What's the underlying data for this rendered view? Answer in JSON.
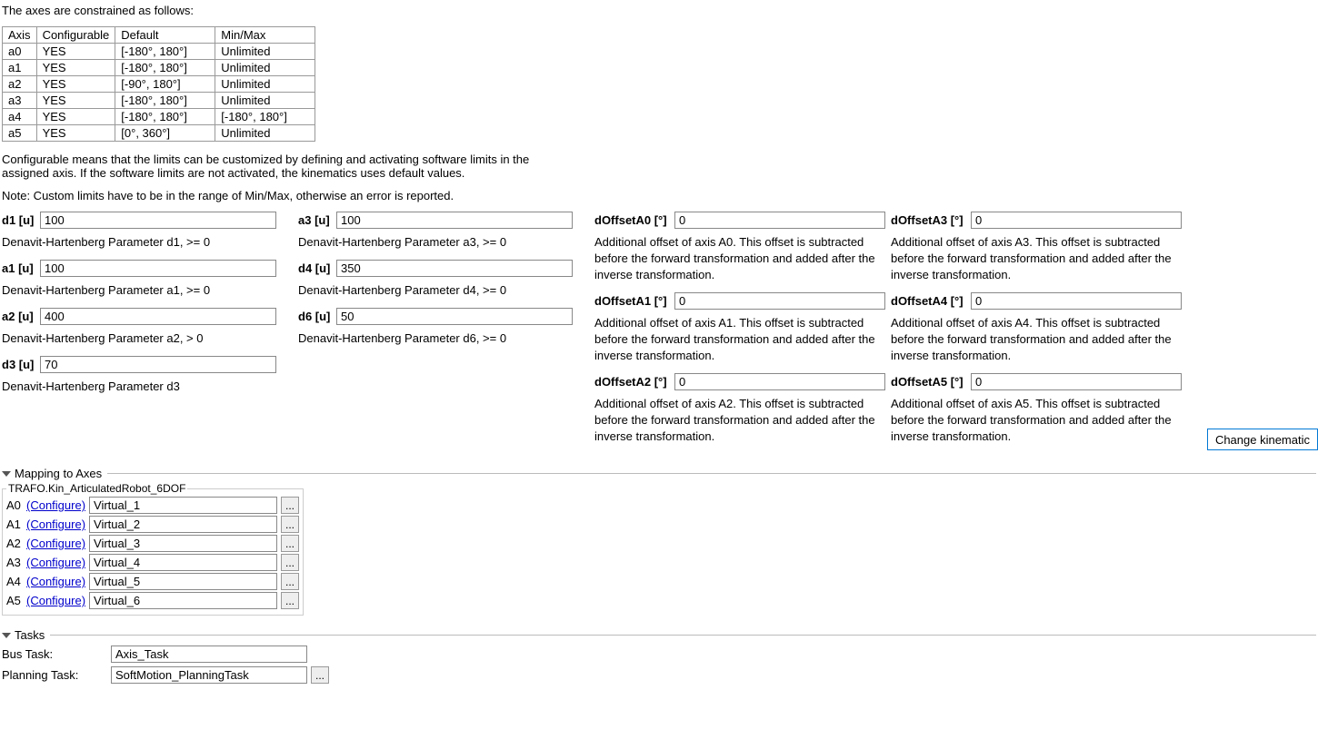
{
  "intro": {
    "heading": "The axes are constrained as follows:",
    "configurable_note": "Configurable means that the limits can be customized by defining and activating software limits in the assigned axis. If the software limits are not activated, the kinematics uses default values.",
    "minmax_note": "Note: Custom limits have to be in the range of Min/Max, otherwise an error is reported."
  },
  "constraint_table": {
    "headers": [
      "Axis",
      "Configurable",
      "Default",
      "Min/Max"
    ],
    "rows": [
      {
        "axis": "a0",
        "config": "YES",
        "default": "[-180°, 180°]",
        "minmax": "Unlimited"
      },
      {
        "axis": "a1",
        "config": "YES",
        "default": "[-180°, 180°]",
        "minmax": "Unlimited"
      },
      {
        "axis": "a2",
        "config": "YES",
        "default": "[-90°, 180°]",
        "minmax": "Unlimited"
      },
      {
        "axis": "a3",
        "config": "YES",
        "default": "[-180°, 180°]",
        "minmax": "Unlimited"
      },
      {
        "axis": "a4",
        "config": "YES",
        "default": "[-180°, 180°]",
        "minmax": "[-180°, 180°]"
      },
      {
        "axis": "a5",
        "config": "YES",
        "default": "[0°, 360°]",
        "minmax": "Unlimited"
      }
    ]
  },
  "dh_params": {
    "d1": {
      "label": "d1 [u]",
      "value": "100",
      "desc": "Denavit-Hartenberg Parameter d1, >= 0"
    },
    "a1": {
      "label": "a1 [u]",
      "value": "100",
      "desc": "Denavit-Hartenberg Parameter a1, >= 0"
    },
    "a2": {
      "label": "a2 [u]",
      "value": "400",
      "desc": "Denavit-Hartenberg Parameter a2, > 0"
    },
    "d3": {
      "label": "d3 [u]",
      "value": "70",
      "desc": "Denavit-Hartenberg Parameter d3"
    },
    "a3": {
      "label": "a3 [u]",
      "value": "100",
      "desc": "Denavit-Hartenberg Parameter a3, >= 0"
    },
    "d4": {
      "label": "d4 [u]",
      "value": "350",
      "desc": "Denavit-Hartenberg Parameter d4, >= 0"
    },
    "d6": {
      "label": "d6 [u]",
      "value": "50",
      "desc": "Denavit-Hartenberg Parameter d6, >= 0"
    }
  },
  "offsets": {
    "A0": {
      "label": "dOffsetA0 [°]",
      "value": "0",
      "desc": "Additional offset of axis A0. This offset is subtracted before the forward transformation and added after the inverse transformation."
    },
    "A1": {
      "label": "dOffsetA1 [°]",
      "value": "0",
      "desc": "Additional offset of axis A1. This offset is subtracted before the forward transformation and added after the inverse transformation."
    },
    "A2": {
      "label": "dOffsetA2 [°]",
      "value": "0",
      "desc": "Additional offset of axis A2. This offset is subtracted before the forward transformation and added after the inverse transformation."
    },
    "A3": {
      "label": "dOffsetA3 [°]",
      "value": "0",
      "desc": "Additional offset of axis A3. This offset is subtracted before the forward transformation and added after the inverse transformation."
    },
    "A4": {
      "label": "dOffsetA4 [°]",
      "value": "0",
      "desc": "Additional offset of axis A4. This offset is subtracted before the forward transformation and added after the inverse transformation."
    },
    "A5": {
      "label": "dOffsetA5 [°]",
      "value": "0",
      "desc": "Additional offset of axis A5. This offset is subtracted before the forward transformation and added after the inverse transformation."
    }
  },
  "change_kin_button": "Change kinematic",
  "mapping": {
    "section_title": "Mapping to Axes",
    "legend": "TRAFO.Kin_ArticulatedRobot_6DOF",
    "configure_label": "(Configure)",
    "ellipsis": "...",
    "rows": [
      {
        "axis": "A0",
        "value": "Virtual_1"
      },
      {
        "axis": "A1",
        "value": "Virtual_2"
      },
      {
        "axis": "A2",
        "value": "Virtual_3"
      },
      {
        "axis": "A3",
        "value": "Virtual_4"
      },
      {
        "axis": "A4",
        "value": "Virtual_5"
      },
      {
        "axis": "A5",
        "value": "Virtual_6"
      }
    ]
  },
  "tasks": {
    "section_title": "Tasks",
    "bus_label": "Bus Task:",
    "bus_value": "Axis_Task",
    "plan_label": "Planning Task:",
    "plan_value": "SoftMotion_PlanningTask",
    "ellipsis": "..."
  }
}
